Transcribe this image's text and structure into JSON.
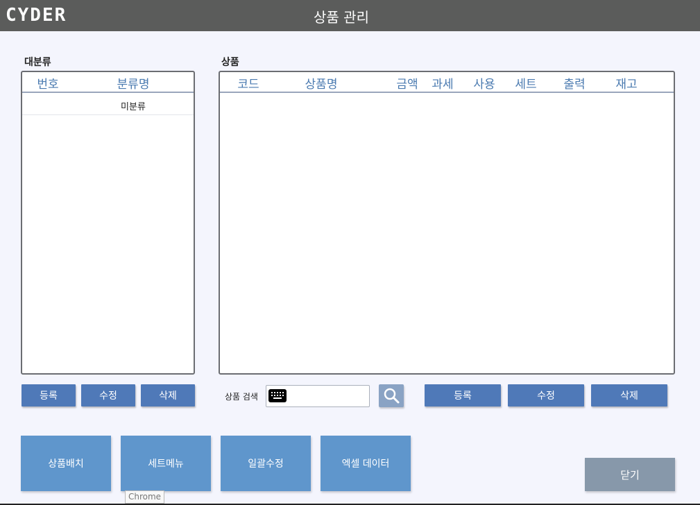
{
  "app": {
    "logo": "CYDER",
    "title": "상품 관리"
  },
  "category": {
    "label": "대분류",
    "columns": [
      "번호",
      "분류명"
    ],
    "rows": [
      {
        "number": "",
        "name": "미분류"
      }
    ],
    "buttons": {
      "register": "등록",
      "edit": "수정",
      "delete": "삭제"
    }
  },
  "product": {
    "label": "상품",
    "columns": [
      "코드",
      "상품명",
      "금액",
      "과세",
      "사용",
      "세트",
      "출력",
      "재고"
    ],
    "rows": [],
    "search": {
      "label": "상품 검색",
      "value": ""
    },
    "buttons": {
      "register": "등록",
      "edit": "수정",
      "delete": "삭제"
    }
  },
  "actions": {
    "placement": "상품배치",
    "set_menu": "세트메뉴",
    "bulk_edit": "일괄수정",
    "excel_data": "엑셀 데이터",
    "close": "닫기"
  },
  "tooltip": "Chrome",
  "icons": [
    "keyboard-icon",
    "search-icon"
  ],
  "colors": {
    "titlebar": "#5b5c5b",
    "button": "#4f79b8",
    "big_button": "#5f96cc",
    "close_button": "#8798aa",
    "header_text": "#4a7ab0"
  }
}
